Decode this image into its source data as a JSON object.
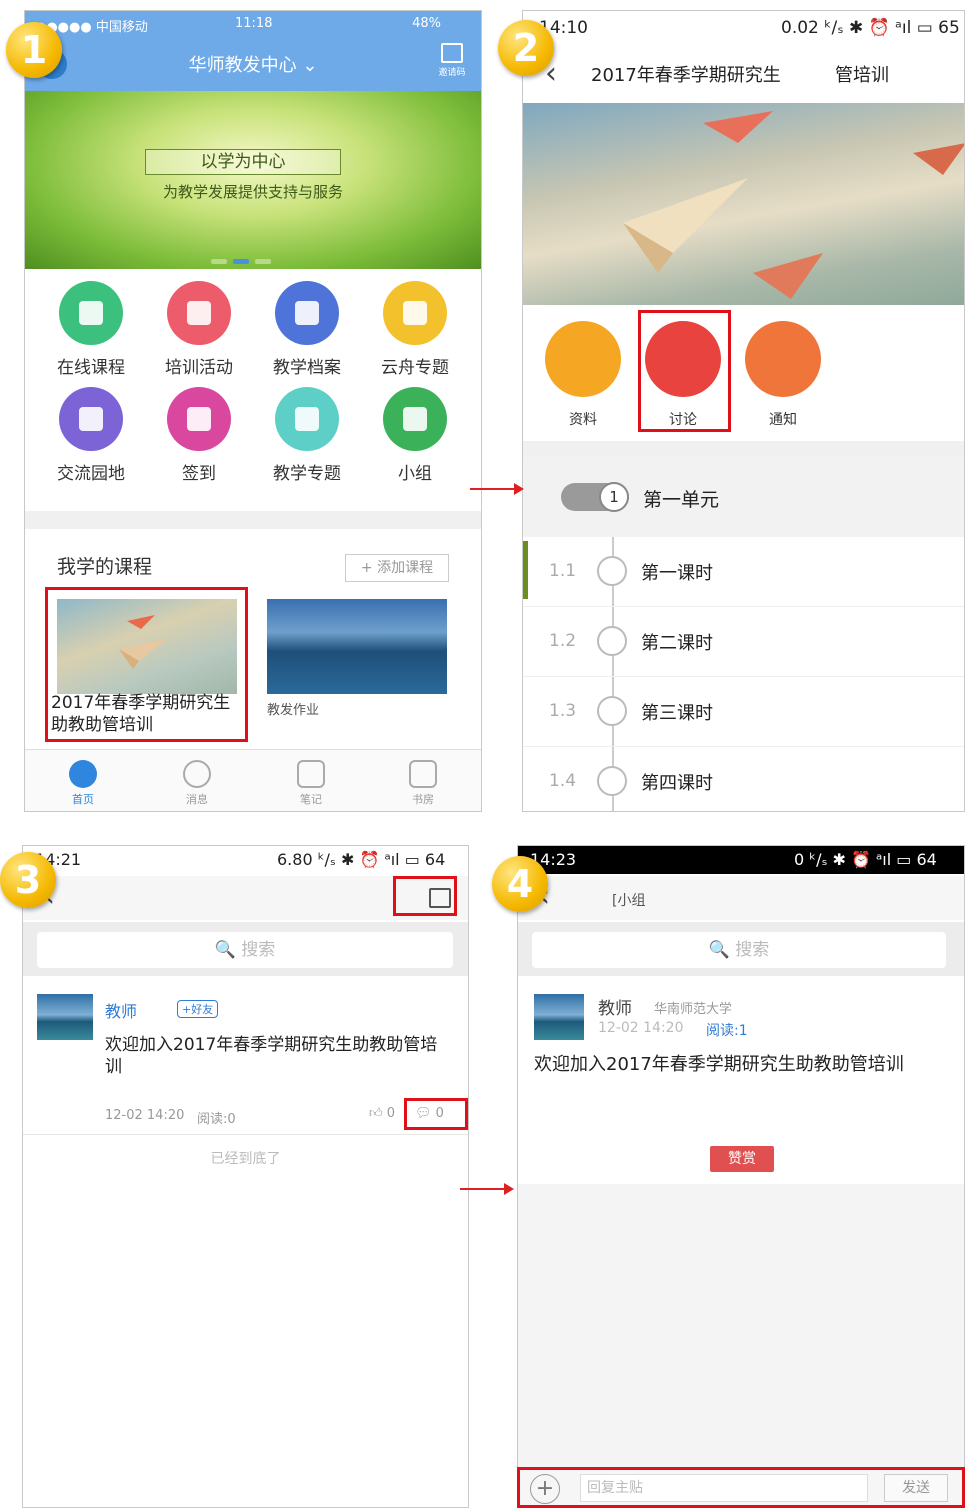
{
  "steps": [
    "1",
    "2",
    "3",
    "4"
  ],
  "panel1": {
    "status": {
      "carrier": "●●●●● 中国移动",
      "time": "11:18",
      "battery": "48%"
    },
    "header": {
      "title": "华师教发中心 ⌄",
      "scan_label": "邀请码"
    },
    "banner": {
      "title": "以学为中心",
      "subtitle": "为教学发展提供支持与服务"
    },
    "grid": [
      {
        "label": "在线课程",
        "color": "#3cc07e"
      },
      {
        "label": "培训活动",
        "color": "#ec5c6a"
      },
      {
        "label": "教学档案",
        "color": "#4f74d9"
      },
      {
        "label": "云舟专题",
        "color": "#f3c12c"
      },
      {
        "label": "交流园地",
        "color": "#7c63d6"
      },
      {
        "label": "签到",
        "color": "#d9489e"
      },
      {
        "label": "教学专题",
        "color": "#5dcfc7"
      },
      {
        "label": "小组",
        "color": "#3bb25a"
      }
    ],
    "my_courses": "我学的课程",
    "add_course": "+ 添加课程",
    "courses": [
      {
        "title": "2017年春季学期研究生助教助管培训"
      },
      {
        "title": "教发作业"
      }
    ],
    "tabs": [
      "首页",
      "消息",
      "笔记",
      "书房"
    ]
  },
  "panel2": {
    "status": {
      "time": "14:10",
      "right": "0.02 ᵏ/ₛ ✱ ⏰ ᵃıl ▭ 65"
    },
    "title": "2017年春季学期研究生",
    "title_suffix": "管培训",
    "actions": [
      {
        "label": "资料",
        "color": "#f5a623"
      },
      {
        "label": "讨论",
        "color": "#e8433f"
      },
      {
        "label": "通知",
        "color": "#f0753a"
      }
    ],
    "unit": {
      "number": "1",
      "label": "第一单元"
    },
    "lessons": [
      {
        "num": "1.1",
        "name": "第一课时"
      },
      {
        "num": "1.2",
        "name": "第二课时"
      },
      {
        "num": "1.3",
        "name": "第三课时"
      },
      {
        "num": "1.4",
        "name": "第四课时"
      }
    ]
  },
  "panel3": {
    "status": {
      "time": "14:21",
      "right": "6.80 ᵏ/ₛ ✱ ⏰ ᵃıl ▭ 64"
    },
    "search_placeholder": "🔍 搜索",
    "post": {
      "author": "教师",
      "tag": "+好友",
      "body": "欢迎加入2017年春季学期研究生助教助管培训",
      "time": "12-02 14:20",
      "reads": "阅读:0",
      "likes": "0",
      "comments": "0"
    },
    "end": "已经到底了"
  },
  "panel4": {
    "status": {
      "time": "14:23",
      "right": "0 ᵏ/ₛ ✱ ⏰ ᵃıl ▭ 64"
    },
    "title": "[小组",
    "search_placeholder": "🔍 搜索",
    "post": {
      "author": "教师",
      "school": "华南师范大学",
      "time": "12-02 14:20",
      "reads": "阅读:1",
      "body": "欢迎加入2017年春季学期研究生助教助管培训"
    },
    "reward": "赞赏",
    "reply_placeholder": "回复主贴",
    "send": "发送"
  }
}
